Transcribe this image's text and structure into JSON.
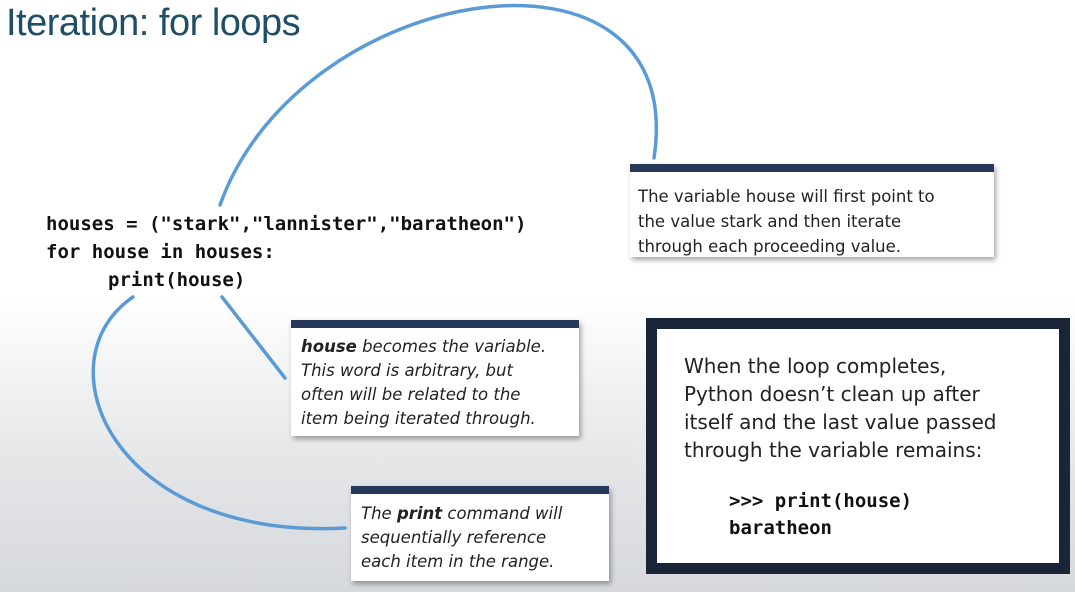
{
  "slide": {
    "title": "Iteration: for loops"
  },
  "code": {
    "lines": [
      "houses = (\"stark\",\"lannister\",\"baratheon\")",
      "for house in houses:",
      "print(house)"
    ]
  },
  "callouts": {
    "variable_point": {
      "lines": [
        "The variable house will first point to",
        "the value stark and then iterate",
        "through each proceeding value."
      ]
    },
    "loop_variable": {
      "keyword": "house",
      "line1_rest": " becomes the variable.",
      "lines": [
        "This word is arbitrary, but",
        "often will be related to the",
        "item being iterated through."
      ]
    },
    "print_command": {
      "prefix": "The ",
      "keyword": "print",
      "line1_rest": " command will",
      "lines": [
        "sequentially reference",
        "each item in the range."
      ]
    }
  },
  "note": {
    "lines": [
      "When the loop completes,",
      "Python doesn’t clean up after",
      "itself and the last value passed",
      "through the variable remains:"
    ],
    "sample_lines": [
      ">>> print(house)",
      "baratheon"
    ]
  },
  "colors": {
    "title": "#1f4e66",
    "callout_bar": "#27395a",
    "note_border": "#1a2538",
    "arrow": "#5b9bd5"
  }
}
